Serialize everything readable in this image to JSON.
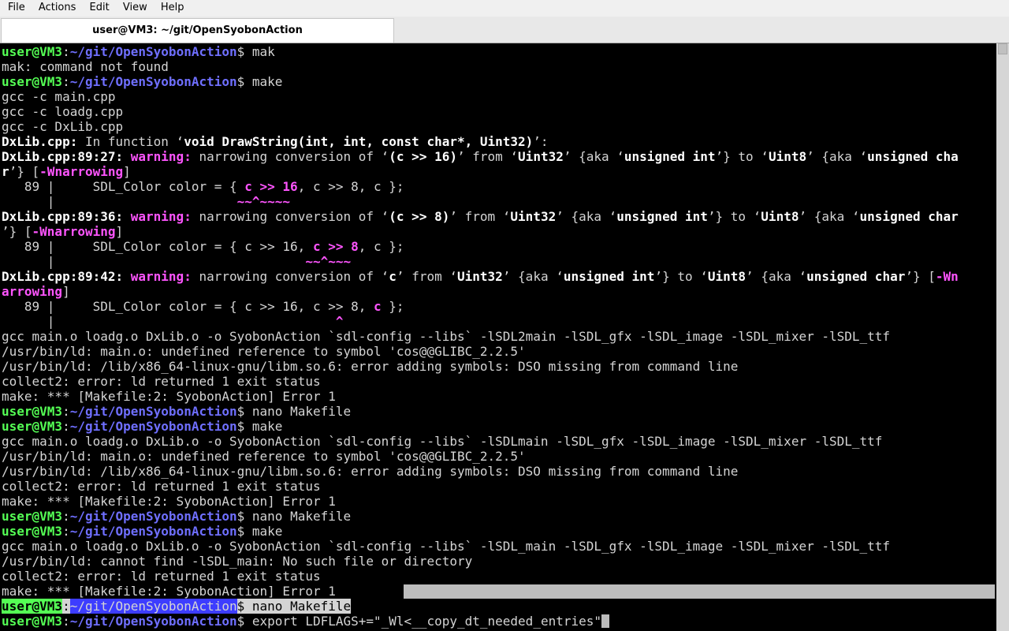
{
  "menu": [
    "File",
    "Actions",
    "Edit",
    "View",
    "Help"
  ],
  "tab_title": "user@VM3: ~/git/OpenSyobonAction",
  "prompt": {
    "user": "user@VM3",
    "sep": ":",
    "path": "~/git/OpenSyobonAction",
    "dollar": "$"
  },
  "lines": {
    "l0": " mak",
    "l1": "mak: command not found",
    "l2": " make",
    "l3": "gcc -c main.cpp",
    "l4": "gcc -c loadg.cpp",
    "l5": "gcc -c DxLib.cpp",
    "l6a": "DxLib.cpp:",
    "l6b": " In function ‘",
    "l6c": "void DrawString(int, int, const char*, Uint32)",
    "l6d": "’:",
    "w1loc": "DxLib.cpp:89:27:",
    "w2loc": "DxLib.cpp:89:36:",
    "w3loc": "DxLib.cpp:89:42:",
    "warn": " warning:",
    "narrow": " narrowing conversion of ‘",
    "w1expr": "(c >> 16)",
    "w2expr": "(c >> 8)",
    "w3expr": "c",
    "from": "’ from ‘",
    "uint32": "Uint32",
    "aka1": "’ {aka ‘",
    "uint": "unsigned int",
    "to": "’} to ‘",
    "uint8": "Uint8",
    "aka2": "’ {aka ‘",
    "uchar_trunc": "unsigned cha",
    "uchar": "unsigned char",
    "w1tail_a": "r",
    "w1tail_b": "’} [",
    "wnarrowing": "-Wnarrowing",
    "close": "]",
    "w2tail_a": "’} [",
    "w3tail_a": "’} [",
    "w3flag_a": "-Wn",
    "w3flag_b": "arrowing",
    "gutter89": "   89 |     SDL_Color color = { ",
    "gutter": "      |",
    "src1_hl": "c >> 16",
    "src1_rest": ", c >> 8, c };",
    "src2_pre": "c >> 16, ",
    "src2_hl": "c >> 8",
    "src2_rest": ", c };",
    "src3_pre": "c >> 16, c >> 8, ",
    "src3_hl": "c",
    "src3_rest": " };",
    "caret1": "~~^~~~~",
    "caret2": "~~^~~~",
    "caret3": "^",
    "link1": "gcc main.o loadg.o DxLib.o -o SyobonAction `sdl-config --libs` -lSDL2main -lSDL_gfx -lSDL_image -lSDL_mixer -lSDL_ttf",
    "ld1": "/usr/bin/ld: main.o: undefined reference to symbol 'cos@@GLIBC_2.2.5'",
    "ld2": "/usr/bin/ld: /lib/x86_64-linux-gnu/libm.so.6: error adding symbols: DSO missing from command line",
    "collect": "collect2: error: ld returned 1 exit status",
    "makeerr": "make: *** [Makefile:2: SyobonAction] Error 1",
    "cmd_nano": " nano Makefile",
    "cmd_make": " make",
    "link2": "gcc main.o loadg.o DxLib.o -o SyobonAction `sdl-config --libs` -lSDLmain -lSDL_gfx -lSDL_image -lSDL_mixer -lSDL_ttf",
    "link3": "gcc main.o loadg.o DxLib.o -o SyobonAction `sdl-config --libs` -lSDL_main -lSDL_gfx -lSDL_image -lSDL_mixer -lSDL_ttf",
    "ld3": "/usr/bin/ld: cannot find -lSDL_main: No such file or directory",
    "cmd_export": " export LDFLAGS+=\"_Wl<__copy_dt_needed_entries\""
  }
}
